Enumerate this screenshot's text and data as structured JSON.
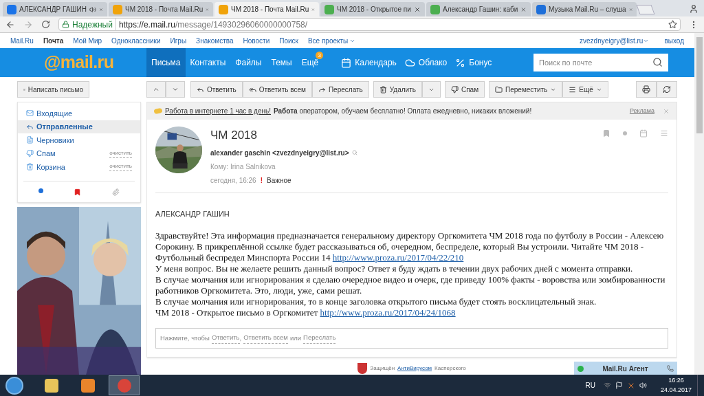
{
  "browser_tabs": [
    {
      "label": "АЛЕКСАНДР ГАШИН",
      "kind": "video",
      "audio": true,
      "selected": false
    },
    {
      "label": "ЧМ 2018 - Почта Mail.Ru",
      "kind": "mail",
      "audio": false,
      "selected": false
    },
    {
      "label": "ЧМ 2018 - Почта Mail.Ru",
      "kind": "mail",
      "audio": false,
      "selected": true
    },
    {
      "label": "ЧМ 2018 - Открытое пи",
      "kind": "page",
      "audio": false,
      "selected": false
    },
    {
      "label": "Александр Гашин: каби",
      "kind": "page",
      "audio": false,
      "selected": false
    },
    {
      "label": "Музыка Mail.Ru – слуша",
      "kind": "music",
      "audio": false,
      "selected": false
    }
  ],
  "address_bar": {
    "security": "Надежный",
    "url_host": "https://e.mail.ru",
    "url_path": "/message/14930296060000000758/"
  },
  "portal_nav": {
    "items": [
      {
        "label": "Mail.Ru",
        "selected": false
      },
      {
        "label": "Почта",
        "selected": true
      },
      {
        "label": "Мой Мир",
        "selected": false
      },
      {
        "label": "Одноклассники",
        "selected": false
      },
      {
        "label": "Игры",
        "selected": false
      },
      {
        "label": "Знакомства",
        "selected": false
      },
      {
        "label": "Новости",
        "selected": false
      },
      {
        "label": "Поиск",
        "selected": false
      },
      {
        "label": "Все проекты",
        "selected": false
      }
    ],
    "user": "zvezdnyeigry@list.ru",
    "logout": "выход"
  },
  "header": {
    "logo": "@mail.ru",
    "tabs": [
      {
        "label": "Письма",
        "selected": true
      },
      {
        "label": "Контакты",
        "selected": false
      },
      {
        "label": "Файлы",
        "selected": false
      },
      {
        "label": "Темы",
        "selected": false
      },
      {
        "label": "Ещё",
        "selected": false,
        "badge": "3"
      }
    ],
    "services": [
      {
        "label": "Календарь",
        "kind": "calendar"
      },
      {
        "label": "Облако",
        "kind": "cloud"
      },
      {
        "label": "Бонус",
        "kind": "bonus"
      }
    ],
    "search": {
      "placeholder": "Поиск по почте"
    }
  },
  "compose": "Написать письмо",
  "toolbar": [
    {
      "label": "Ответить",
      "kind": "reply"
    },
    {
      "label": "Ответить всем",
      "kind": "reply_all"
    },
    {
      "label": "Переслать",
      "kind": "forward"
    },
    {
      "label": "Удалить",
      "kind": "delete"
    },
    {
      "label": "Спам",
      "kind": "spam"
    },
    {
      "label": "Переместить",
      "kind": "move"
    },
    {
      "label": "Ещё",
      "kind": "more"
    }
  ],
  "folders": [
    {
      "label": "Входящие",
      "kind": "inbox",
      "selected": false
    },
    {
      "label": "Отправленные",
      "kind": "sent",
      "selected": true
    },
    {
      "label": "Черновики",
      "kind": "drafts",
      "selected": false
    },
    {
      "label": "Спам",
      "kind": "spam",
      "selected": false,
      "action": "очистить"
    },
    {
      "label": "Корзина",
      "kind": "trash",
      "selected": false,
      "action": "очистить"
    }
  ],
  "ad_line": {
    "link": "Работа в интернете 1 час в день!",
    "text": "**Работа** оператором, обучаем бесплатно! Оплата ежедневно, никаких вложений!",
    "label": "Реклама"
  },
  "message": {
    "subject": "ЧМ 2018",
    "from": "alexander gaschin <zvezdnyeigry@list.ru>",
    "to": "Кому: Irina Salnikova",
    "date": "сегодня, 16:26",
    "importance": "!",
    "importance_label": "Важное",
    "greeting": "АЛЕКСАНДР ГАШИН",
    "body": [
      {
        "text": "Здравствуйте! Эта информация предназначается генеральному директору Оргкомитета ЧМ 2018 года по футболу в России - Алексею Сорокину. В прикреплённой ссылке будет рассказываться об, очередном, беспределе, который Вы устроили. Читайте ЧМ 2018 - Футбольный беспредел Минспорта России 14",
        "link": "http://www.proza.ru/2017/04/22/210"
      },
      {
        "text": "У меня вопрос. Вы не желаете решить данный вопрос? Ответ я буду ждать в течении двух рабочих дней с момента отправки."
      },
      {
        "text": "В случае молчания или игнорирования я сделаю очередное видео и очерк, где приведу 100% факты - воровства или зомбированности работников Оргкомитета. Это, люди, уже, сами решат."
      },
      {
        "text": "В случае молчания или игнорирования, то в конце заголовка открытого письма будет стоять восклицательный знак."
      },
      {
        "text": "ЧМ 2018 - Открытое письмо в Оргкомитет",
        "link": "http://www.proza.ru/2017/04/24/1068"
      }
    ],
    "reply_prompt": [
      {
        "kind": "text",
        "text": "Нажмите, чтобы"
      },
      {
        "kind": "link",
        "text": "Ответить"
      },
      {
        "kind": "text",
        "text": ","
      },
      {
        "kind": "link",
        "text": "Ответить всем"
      },
      {
        "kind": "text",
        "text": "или"
      },
      {
        "kind": "link",
        "text": "Переслать"
      }
    ]
  },
  "footer": {
    "before": "Защищён",
    "link": "АнтиВирусом",
    "after": "Касперского"
  },
  "agent": {
    "label": "Mail.Ru Агент"
  },
  "taskbar": {
    "apps": [
      {
        "kind": "explorer",
        "selected": false
      },
      {
        "kind": "media",
        "selected": false
      },
      {
        "kind": "chrome",
        "selected": true
      }
    ],
    "language": "RU",
    "time": "16:26",
    "date": "24.04.2017"
  }
}
